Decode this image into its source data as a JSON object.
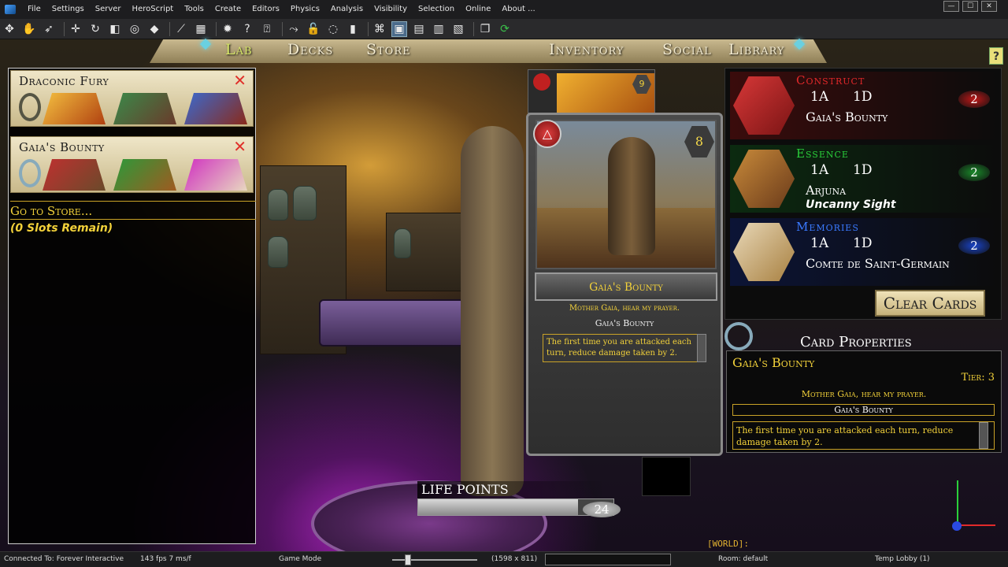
{
  "menu": [
    "File",
    "Settings",
    "Server",
    "HeroScript",
    "Tools",
    "Create",
    "Editors",
    "Physics",
    "Analysis",
    "Visibility",
    "Selection",
    "Online",
    "About ..."
  ],
  "window_controls": [
    "—",
    "☐",
    "✕"
  ],
  "toolbar_icons": [
    "select-icon",
    "grab-icon",
    "pointer-icon",
    "move-icon",
    "rotate-icon",
    "scale-icon",
    "target-icon",
    "gizmo-icon",
    "path-icon",
    "grid-icon",
    "globe-icon",
    "help-icon",
    "help-alt-icon",
    "connect-icon",
    "lock-icon",
    "bulb-icon",
    "cursor-icon",
    "tree-icon",
    "layout-icon",
    "layout2-icon",
    "layout3-icon",
    "layout4-icon",
    "page-icon",
    "refresh-icon"
  ],
  "tabs": [
    "Lab",
    "Decks",
    "Store",
    "Inventory",
    "Social",
    "Library"
  ],
  "active_tab": "Lab",
  "help_label": "?",
  "decks": [
    {
      "name": "Draconic Fury",
      "close": "✕"
    },
    {
      "name": "Gaia's Bounty",
      "close": "✕"
    }
  ],
  "store_link": "Go to Store...",
  "slots_remain": "(0 Slots Remain)",
  "mini_card": {
    "tier": "9"
  },
  "card": {
    "tier": "8",
    "title": "Gaia's Bounty",
    "flavor": "Mother Gaia, hear my prayer.",
    "subtitle": "Gaia's Bounty",
    "text": "The first time you are attacked each turn, reduce damage taken by 2."
  },
  "life": {
    "label": "LIFE POINTS",
    "value": "24",
    "fraction": 0.82
  },
  "world_label": "[WORLD]:",
  "slots": [
    {
      "type": "Construct",
      "a": "1A",
      "d": "1D",
      "count": "2",
      "name": "Gaia's Bounty",
      "sub": "",
      "type_color": "#e2282a",
      "bg": "#3a0c0c",
      "orb": "#c01818"
    },
    {
      "type": "Essence",
      "a": "1A",
      "d": "1D",
      "count": "2",
      "name": "Arjuna",
      "sub": "Uncanny Sight",
      "type_color": "#2ad03a",
      "bg": "#0c2a10",
      "orb": "#1a8a2a"
    },
    {
      "type": "Memories",
      "a": "1A",
      "d": "1D",
      "count": "2",
      "name": "Comte de Saint-Germain",
      "sub": "",
      "type_color": "#3a7aff",
      "bg": "#0c1436",
      "orb": "#1a44c8"
    }
  ],
  "clear_cards": "Clear Cards",
  "card_properties": {
    "title": "Card Properties",
    "name": "Gaia's Bounty",
    "tier": "Tier: 3",
    "flavor": "Mother Gaia, hear my prayer.",
    "subtitle": "Gaia's Bounty",
    "text": "The first time you are attacked each turn, reduce damage taken by 2."
  },
  "status": {
    "connected": "Connected To: Forever Interactive",
    "fps": "143 fps  7 ms/f",
    "mode": "Game Mode",
    "resolution": "(1598 x 811)",
    "room": "Room: default",
    "lobby": "Temp Lobby (1)"
  }
}
